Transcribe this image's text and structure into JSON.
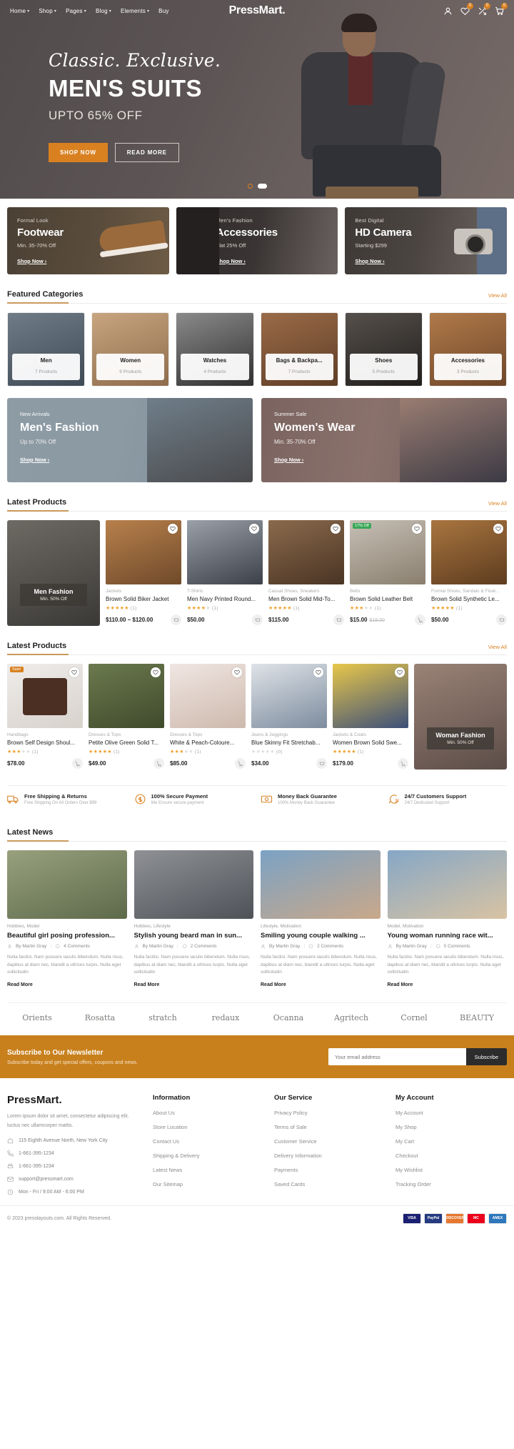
{
  "header": {
    "brand": "PressMart.",
    "nav": [
      {
        "label": "Home",
        "caret": true
      },
      {
        "label": "Shop",
        "caret": true
      },
      {
        "label": "Pages",
        "caret": true
      },
      {
        "label": "Blog",
        "caret": true
      },
      {
        "label": "Elements",
        "caret": true
      },
      {
        "label": "Buy",
        "caret": false
      }
    ],
    "icons": [
      {
        "name": "user-icon",
        "badge": ""
      },
      {
        "name": "wishlist-heart-icon",
        "badge": "0"
      },
      {
        "name": "compare-icon",
        "badge": "0"
      },
      {
        "name": "cart-icon",
        "badge": "0"
      }
    ]
  },
  "hero": {
    "script": "Classic. Exclusive.",
    "title": "MEN'S SUITS",
    "subtitle": "UPTO 65% OFF",
    "shop_label": "SHOP NOW",
    "read_label": "READ MORE"
  },
  "promos": [
    {
      "kicker": "Formal Look",
      "title": "Footwear",
      "desc": "Min. 35-70% Off",
      "link": "Shop Now ›"
    },
    {
      "kicker": "Men's Fashion",
      "title": "Accessories",
      "desc": "Flat 25% Off",
      "link": "Shop Now ›"
    },
    {
      "kicker": "Best Digital",
      "title": "HD Camera",
      "desc": "Starting $299",
      "link": "Shop Now ›"
    }
  ],
  "featured_categories": {
    "title": "Featured Categories",
    "view_all": "View All",
    "items": [
      {
        "name": "Men",
        "count": "7 Products"
      },
      {
        "name": "Women",
        "count": "9 Products"
      },
      {
        "name": "Watches",
        "count": "4 Products"
      },
      {
        "name": "Bags & Backpa...",
        "count": "7 Products"
      },
      {
        "name": "Shoes",
        "count": "5 Products"
      },
      {
        "name": "Accessories",
        "count": "3 Products"
      }
    ]
  },
  "banners": [
    {
      "kicker": "New Arrivals",
      "title": "Men's Fashion",
      "desc": "Up to 70% Off",
      "link": "Shop Now ›"
    },
    {
      "kicker": "Summer Sale",
      "title": "Women's Wear",
      "desc": "Min. 35-70% Off",
      "link": "Shop Now ›"
    }
  ],
  "latest_products_1": {
    "title": "Latest Products",
    "view_all": "View All",
    "feature": {
      "name": "Men Fashion",
      "off": "Min. 50% Off"
    },
    "items": [
      {
        "cat": "Jackets",
        "name": "Brown Solid Biker Jacket",
        "stars": 5,
        "reviews": "(1)",
        "price": "$110.00 – $120.00",
        "old": "",
        "tag": ""
      },
      {
        "cat": "T-Shirts",
        "name": "Men Navy Printed Round...",
        "stars": 4,
        "reviews": "(1)",
        "price": "$50.00",
        "old": "",
        "tag": ""
      },
      {
        "cat": "Casual Shoes, Sneakers",
        "name": "Men Brown Solid Mid-To...",
        "stars": 5,
        "reviews": "(1)",
        "price": "$115.00",
        "old": "",
        "tag": ""
      },
      {
        "cat": "Belts",
        "name": "Brown Solid Leather Belt",
        "stars": 3,
        "reviews": "(1)",
        "price": "$15.00",
        "old": "$18.00",
        "tag": "17% Off"
      },
      {
        "cat": "Formal Shoes, Sandals & Float...",
        "name": "Brown Solid Synthetic Le...",
        "stars": 5,
        "reviews": "(1)",
        "price": "$50.00",
        "old": "",
        "tag": ""
      }
    ]
  },
  "latest_products_2": {
    "title": "Latest Products",
    "view_all": "View All",
    "feature": {
      "name": "Woman Fashion",
      "off": "Min. 50% Off"
    },
    "items": [
      {
        "cat": "Handbags",
        "name": "Brown Self Design Shoul...",
        "stars": 3,
        "reviews": "(1)",
        "price": "$78.00",
        "old": "",
        "tag": "Sale!"
      },
      {
        "cat": "Dresses & Tops",
        "name": "Petite Olive Green Solid T...",
        "stars": 5,
        "reviews": "(1)",
        "price": "$49.00",
        "old": "",
        "tag": ""
      },
      {
        "cat": "Dresses & Tops",
        "name": "White & Peach-Coloure...",
        "stars": 3,
        "reviews": "(1)",
        "price": "$85.00",
        "old": "",
        "tag": ""
      },
      {
        "cat": "Jeans & Jeggings",
        "name": "Blue Skinny Fit Stretchab...",
        "stars": 0,
        "reviews": "(0)",
        "price": "$34.00",
        "old": "",
        "tag": ""
      },
      {
        "cat": "Jackets & Coats",
        "name": "Women Brown Solid Swe...",
        "stars": 5,
        "reviews": "(1)",
        "price": "$179.00",
        "old": "",
        "tag": ""
      }
    ]
  },
  "services": [
    {
      "icon": "truck-icon",
      "title": "Free Shipping & Returns",
      "desc": "Free Shipping On All Orders Over $99"
    },
    {
      "icon": "shield-dollar-icon",
      "title": "100% Secure Payment",
      "desc": "We Ensure secure payment"
    },
    {
      "icon": "money-back-icon",
      "title": "Money Back Guarantee",
      "desc": "100% Money Back Guarantee"
    },
    {
      "icon": "support-chat-icon",
      "title": "24/7 Customers Support",
      "desc": "24/7 Dedicated Support"
    }
  ],
  "latest_news": {
    "title": "Latest News",
    "items": [
      {
        "cat": "Hobbies, Model",
        "title": "Beautiful girl posing profession...",
        "author": "By Martin Gray",
        "comments": "4 Comments",
        "excerpt": "Nulla facilisi. Nam posuere iaculis bibendum. Nulla risus, dapibus at diam nec, blandit a ultrices turpis. Nulla eget sollicitudin",
        "more": "Read More"
      },
      {
        "cat": "Hobbies, Lifestyle",
        "title": "Stylish young beard man in sun...",
        "author": "By Martin Gray",
        "comments": "2 Comments",
        "excerpt": "Nulla facilisi. Nam posuere iaculis bibendum. Nulla risus, dapibus at diam nec, blandit a ultrices turpis. Nulla eget sollicitudin",
        "more": "Read More"
      },
      {
        "cat": "Lifestyle, Motivation",
        "title": "Smiling young couple walking ...",
        "author": "By Martin Gray",
        "comments": "2 Comments",
        "excerpt": "Nulla facilisi. Nam posuere iaculis bibendum. Nulla risus, dapibus at diam nec, blandit a ultrices turpis. Nulla eget sollicitudin",
        "more": "Read More"
      },
      {
        "cat": "Model, Motivation",
        "title": "Young woman running race wit...",
        "author": "By Martin Gray",
        "comments": "0 Comments",
        "excerpt": "Nulla facilisi. Nam posuere iaculis bibendum. Nulla risus, dapibus at diam nec, blandit a ultrices turpis. Nulla eget sollicitudin",
        "more": "Read More"
      }
    ]
  },
  "brands": [
    "Orients",
    "Rosatta",
    "stratch",
    "redaux",
    "Ocanna",
    "Agritech",
    "Cornel",
    "BEAUTY"
  ],
  "newsletter": {
    "title": "Subscribe to Our Newsletter",
    "desc": "Subscribe today and get special offers, coupons and news.",
    "placeholder": "Your email address",
    "button": "Subscribe"
  },
  "footer": {
    "logo": "PressMart.",
    "desc": "Lorem ipsum dolor sit amet, consectetur adipiscing elit. luctus nec ullamcorper mattis.",
    "contacts": [
      {
        "icon": "home-icon",
        "text": "115 Eighth Avenue North, New York City"
      },
      {
        "icon": "phone-icon",
        "text": "1-661-395-1234"
      },
      {
        "icon": "fax-icon",
        "text": "1-661-395-1234"
      },
      {
        "icon": "mail-icon",
        "text": "support@pressmart.com"
      },
      {
        "icon": "clock-icon",
        "text": "Mon - Fri / 9:00 AM - 6:00 PM"
      }
    ],
    "columns": [
      {
        "title": "Information",
        "links": [
          "About Us",
          "Store Location",
          "Contact Us",
          "Shipping & Delivery",
          "Latest News",
          "Our Sitemap"
        ]
      },
      {
        "title": "Our Service",
        "links": [
          "Privacy Policy",
          "Terms of Sale",
          "Customer Service",
          "Delivery Information",
          "Payments",
          "Saved Cards"
        ]
      },
      {
        "title": "My Account",
        "links": [
          "My Account",
          "My Shop",
          "My Cart",
          "Checkout",
          "My Wishlist",
          "Tracking Order"
        ]
      }
    ],
    "copyright": "© 2023 presslayouts.com. All Rights Reserved.",
    "payments": [
      {
        "label": "VISA",
        "color": "#1a1f71"
      },
      {
        "label": "PayPal",
        "color": "#253b80"
      },
      {
        "label": "DISCOVER",
        "color": "#e6772e"
      },
      {
        "label": "MC",
        "color": "#eb001b"
      },
      {
        "label": "AMEX",
        "color": "#2e77bc"
      }
    ]
  },
  "colors": {
    "accent": "#d98121",
    "brand_dark": "#2c2c2c",
    "newsletter_bg": "#c8801d"
  }
}
